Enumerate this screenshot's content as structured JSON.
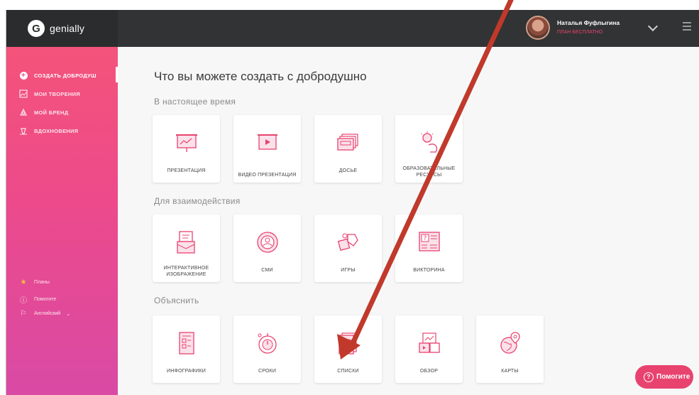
{
  "app": {
    "logo_text": "genially",
    "logo_letter": "G"
  },
  "user": {
    "name": "Наталья Фуфлыгина",
    "plan": "ПЛАН БЕСПЛАТНО"
  },
  "sidebar": {
    "items": [
      {
        "label": "СОЗДАТЬ ДОБРОДУШ",
        "icon": "plus-icon",
        "active": true
      },
      {
        "label": "МОИ ТВОРЕНИЯ",
        "icon": "image-icon",
        "active": false
      },
      {
        "label": "МОЙ БРЕНД",
        "icon": "brand-icon",
        "active": false
      },
      {
        "label": "ВДОХНОВЕНИЯ",
        "icon": "inspiration-icon",
        "active": false
      }
    ],
    "bottom": [
      {
        "label": "Планы",
        "icon": "star-icon"
      },
      {
        "label": "Помогите",
        "icon": "info-icon"
      },
      {
        "label": "Английский",
        "icon": "flag-icon"
      }
    ]
  },
  "main": {
    "title": "Что вы можете создать с добродушно",
    "sections": [
      {
        "title": "В настоящее время",
        "cards": [
          "ПРЕЗЕНТАЦИЯ",
          "ВИДЕО ПРЕЗЕНТАЦИЯ",
          "ДОСЬЕ",
          "ОБРАЗОВАТЕЛЬНЫЕ РЕСУРСЫ"
        ]
      },
      {
        "title": "Для взаимодействия",
        "cards": [
          "ИНТЕРАКТИВНОЕ ИЗОБРАЖЕНИЕ",
          "СМИ",
          "ИГРЫ",
          "ВИКТОРИНА"
        ]
      },
      {
        "title": "Объяснить",
        "cards": [
          "ИНФОГРАФИКИ",
          "СРОКИ",
          "СПИСКИ",
          "ОБЗОР",
          "КАРТЫ"
        ]
      }
    ]
  },
  "help_button": {
    "label": "Помогите"
  },
  "colors": {
    "accent": "#e8436f",
    "topbar": "#323334",
    "annotation_arrow": "#c0392b"
  }
}
